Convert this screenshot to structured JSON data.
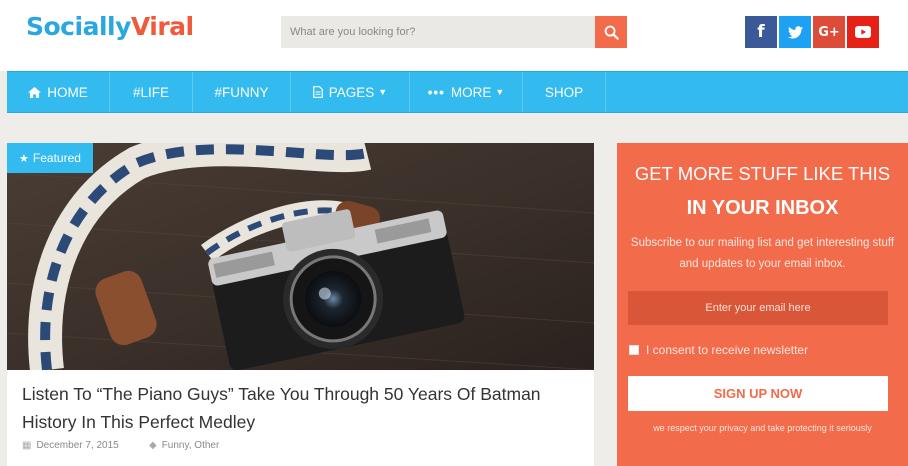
{
  "logo": {
    "part1": "Socially",
    "part2": "Viral"
  },
  "search": {
    "placeholder": "What are you looking for?",
    "icon": "search-icon"
  },
  "social": [
    {
      "name": "facebook",
      "glyph": "f",
      "color": "#3b5998"
    },
    {
      "name": "twitter",
      "glyph": "twitter",
      "color": "#1da1f2"
    },
    {
      "name": "google-plus",
      "glyph": "G+",
      "color": "#dd4b39"
    },
    {
      "name": "youtube",
      "glyph": "youtube",
      "color": "#e62117"
    }
  ],
  "nav": {
    "items": [
      {
        "label": "HOME",
        "icon": "home-icon"
      },
      {
        "label": "#LIFE"
      },
      {
        "label": "#FUNNY"
      },
      {
        "label": "PAGES",
        "icon": "file-icon",
        "dropdown": true
      },
      {
        "label": "MORE",
        "icon": "ellipsis-icon",
        "dropdown": true
      },
      {
        "label": "SHOP"
      }
    ]
  },
  "featured": {
    "badge": "Featured",
    "badge_icon": "star-icon",
    "title": "Listen To “The Piano Guys” Take You Through 50 Years Of Batman History In This Perfect Medley",
    "date": "December 7, 2015",
    "categories": "Funny, Other"
  },
  "newsletter": {
    "line1": "GET MORE STUFF LIKE THIS",
    "line2": "IN YOUR INBOX",
    "description": "Subscribe to our mailing list and get interesting stuff and updates to your email inbox.",
    "email_placeholder": "Enter your email here",
    "consent": "I consent to receive newsletter",
    "button": "SIGN UP NOW",
    "privacy": "we respect your privacy and take protecting it seriously"
  },
  "colors": {
    "accent_blue": "#33bbf0",
    "accent_orange": "#f26b4b",
    "background": "#efedea"
  }
}
